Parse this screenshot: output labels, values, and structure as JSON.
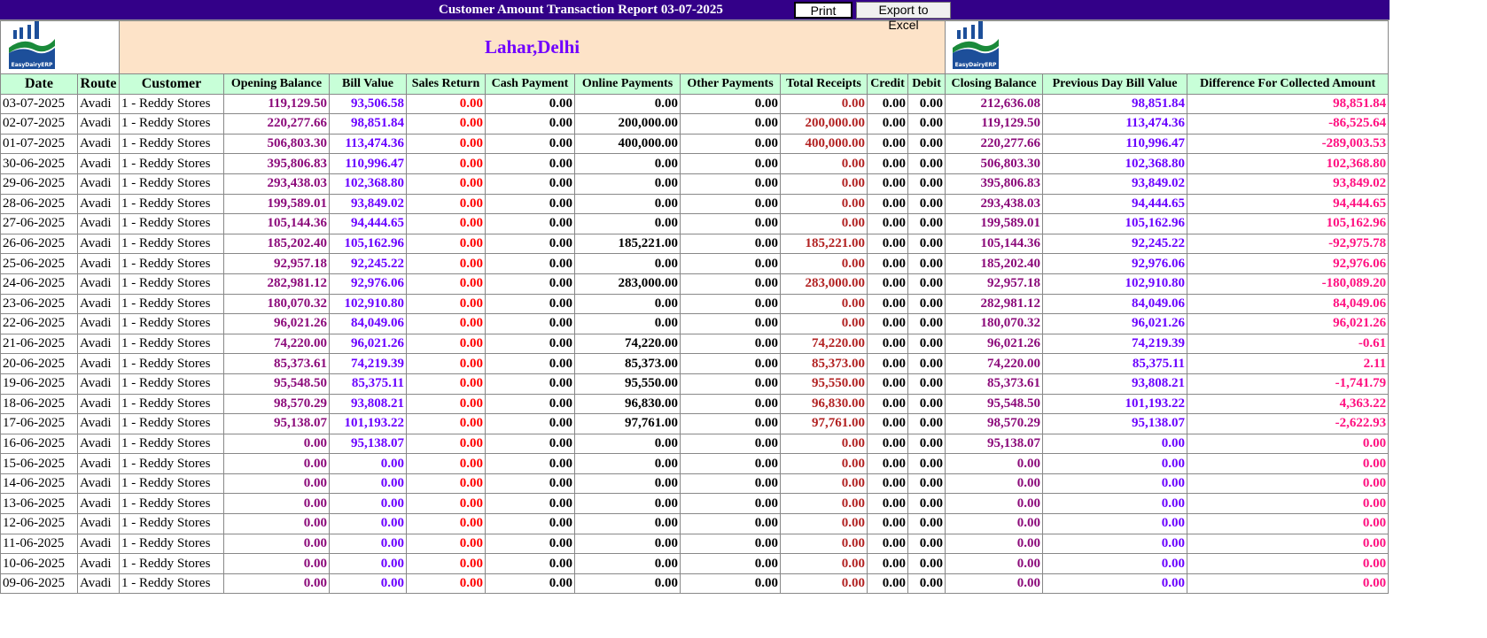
{
  "header": {
    "title": "Customer Amount Transaction Report 03-07-2025",
    "print_label": "Print",
    "export_label": "Export to Excel"
  },
  "company": {
    "name": "Lahar,Delhi",
    "logo_text": "EasyDairyERP"
  },
  "columns": [
    "Date",
    "Route",
    "Customer",
    "Opening Balance",
    "Bill Value",
    "Sales Return",
    "Cash Payment",
    "Online Payments",
    "Other Payments",
    "Total Receipts",
    "Credit",
    "Debit",
    "Closing Balance",
    "Previous Day Bill Value",
    "Difference For Collected Amount"
  ],
  "colors": {
    "title_bar": "#330088",
    "header_bg": "#c8ffd8",
    "company_bg": "#fde3c8",
    "opening": "#8b0a7a",
    "bill": "#6a00ff",
    "sales_return": "#ff0000",
    "receipts": "#b22222",
    "difference": "#ff1080"
  },
  "rows": [
    [
      "03-07-2025",
      "Avadi",
      "1 - Reddy Stores",
      "119,129.50",
      "93,506.58",
      "0.00",
      "0.00",
      "0.00",
      "0.00",
      "0.00",
      "0.00",
      "0.00",
      "212,636.08",
      "98,851.84",
      "98,851.84"
    ],
    [
      "02-07-2025",
      "Avadi",
      "1 - Reddy Stores",
      "220,277.66",
      "98,851.84",
      "0.00",
      "0.00",
      "200,000.00",
      "0.00",
      "200,000.00",
      "0.00",
      "0.00",
      "119,129.50",
      "113,474.36",
      "-86,525.64"
    ],
    [
      "01-07-2025",
      "Avadi",
      "1 - Reddy Stores",
      "506,803.30",
      "113,474.36",
      "0.00",
      "0.00",
      "400,000.00",
      "0.00",
      "400,000.00",
      "0.00",
      "0.00",
      "220,277.66",
      "110,996.47",
      "-289,003.53"
    ],
    [
      "30-06-2025",
      "Avadi",
      "1 - Reddy Stores",
      "395,806.83",
      "110,996.47",
      "0.00",
      "0.00",
      "0.00",
      "0.00",
      "0.00",
      "0.00",
      "0.00",
      "506,803.30",
      "102,368.80",
      "102,368.80"
    ],
    [
      "29-06-2025",
      "Avadi",
      "1 - Reddy Stores",
      "293,438.03",
      "102,368.80",
      "0.00",
      "0.00",
      "0.00",
      "0.00",
      "0.00",
      "0.00",
      "0.00",
      "395,806.83",
      "93,849.02",
      "93,849.02"
    ],
    [
      "28-06-2025",
      "Avadi",
      "1 - Reddy Stores",
      "199,589.01",
      "93,849.02",
      "0.00",
      "0.00",
      "0.00",
      "0.00",
      "0.00",
      "0.00",
      "0.00",
      "293,438.03",
      "94,444.65",
      "94,444.65"
    ],
    [
      "27-06-2025",
      "Avadi",
      "1 - Reddy Stores",
      "105,144.36",
      "94,444.65",
      "0.00",
      "0.00",
      "0.00",
      "0.00",
      "0.00",
      "0.00",
      "0.00",
      "199,589.01",
      "105,162.96",
      "105,162.96"
    ],
    [
      "26-06-2025",
      "Avadi",
      "1 - Reddy Stores",
      "185,202.40",
      "105,162.96",
      "0.00",
      "0.00",
      "185,221.00",
      "0.00",
      "185,221.00",
      "0.00",
      "0.00",
      "105,144.36",
      "92,245.22",
      "-92,975.78"
    ],
    [
      "25-06-2025",
      "Avadi",
      "1 - Reddy Stores",
      "92,957.18",
      "92,245.22",
      "0.00",
      "0.00",
      "0.00",
      "0.00",
      "0.00",
      "0.00",
      "0.00",
      "185,202.40",
      "92,976.06",
      "92,976.06"
    ],
    [
      "24-06-2025",
      "Avadi",
      "1 - Reddy Stores",
      "282,981.12",
      "92,976.06",
      "0.00",
      "0.00",
      "283,000.00",
      "0.00",
      "283,000.00",
      "0.00",
      "0.00",
      "92,957.18",
      "102,910.80",
      "-180,089.20"
    ],
    [
      "23-06-2025",
      "Avadi",
      "1 - Reddy Stores",
      "180,070.32",
      "102,910.80",
      "0.00",
      "0.00",
      "0.00",
      "0.00",
      "0.00",
      "0.00",
      "0.00",
      "282,981.12",
      "84,049.06",
      "84,049.06"
    ],
    [
      "22-06-2025",
      "Avadi",
      "1 - Reddy Stores",
      "96,021.26",
      "84,049.06",
      "0.00",
      "0.00",
      "0.00",
      "0.00",
      "0.00",
      "0.00",
      "0.00",
      "180,070.32",
      "96,021.26",
      "96,021.26"
    ],
    [
      "21-06-2025",
      "Avadi",
      "1 - Reddy Stores",
      "74,220.00",
      "96,021.26",
      "0.00",
      "0.00",
      "74,220.00",
      "0.00",
      "74,220.00",
      "0.00",
      "0.00",
      "96,021.26",
      "74,219.39",
      "-0.61"
    ],
    [
      "20-06-2025",
      "Avadi",
      "1 - Reddy Stores",
      "85,373.61",
      "74,219.39",
      "0.00",
      "0.00",
      "85,373.00",
      "0.00",
      "85,373.00",
      "0.00",
      "0.00",
      "74,220.00",
      "85,375.11",
      "2.11"
    ],
    [
      "19-06-2025",
      "Avadi",
      "1 - Reddy Stores",
      "95,548.50",
      "85,375.11",
      "0.00",
      "0.00",
      "95,550.00",
      "0.00",
      "95,550.00",
      "0.00",
      "0.00",
      "85,373.61",
      "93,808.21",
      "-1,741.79"
    ],
    [
      "18-06-2025",
      "Avadi",
      "1 - Reddy Stores",
      "98,570.29",
      "93,808.21",
      "0.00",
      "0.00",
      "96,830.00",
      "0.00",
      "96,830.00",
      "0.00",
      "0.00",
      "95,548.50",
      "101,193.22",
      "4,363.22"
    ],
    [
      "17-06-2025",
      "Avadi",
      "1 - Reddy Stores",
      "95,138.07",
      "101,193.22",
      "0.00",
      "0.00",
      "97,761.00",
      "0.00",
      "97,761.00",
      "0.00",
      "0.00",
      "98,570.29",
      "95,138.07",
      "-2,622.93"
    ],
    [
      "16-06-2025",
      "Avadi",
      "1 - Reddy Stores",
      "0.00",
      "95,138.07",
      "0.00",
      "0.00",
      "0.00",
      "0.00",
      "0.00",
      "0.00",
      "0.00",
      "95,138.07",
      "0.00",
      "0.00"
    ],
    [
      "15-06-2025",
      "Avadi",
      "1 - Reddy Stores",
      "0.00",
      "0.00",
      "0.00",
      "0.00",
      "0.00",
      "0.00",
      "0.00",
      "0.00",
      "0.00",
      "0.00",
      "0.00",
      "0.00"
    ],
    [
      "14-06-2025",
      "Avadi",
      "1 - Reddy Stores",
      "0.00",
      "0.00",
      "0.00",
      "0.00",
      "0.00",
      "0.00",
      "0.00",
      "0.00",
      "0.00",
      "0.00",
      "0.00",
      "0.00"
    ],
    [
      "13-06-2025",
      "Avadi",
      "1 - Reddy Stores",
      "0.00",
      "0.00",
      "0.00",
      "0.00",
      "0.00",
      "0.00",
      "0.00",
      "0.00",
      "0.00",
      "0.00",
      "0.00",
      "0.00"
    ],
    [
      "12-06-2025",
      "Avadi",
      "1 - Reddy Stores",
      "0.00",
      "0.00",
      "0.00",
      "0.00",
      "0.00",
      "0.00",
      "0.00",
      "0.00",
      "0.00",
      "0.00",
      "0.00",
      "0.00"
    ],
    [
      "11-06-2025",
      "Avadi",
      "1 - Reddy Stores",
      "0.00",
      "0.00",
      "0.00",
      "0.00",
      "0.00",
      "0.00",
      "0.00",
      "0.00",
      "0.00",
      "0.00",
      "0.00",
      "0.00"
    ],
    [
      "10-06-2025",
      "Avadi",
      "1 - Reddy Stores",
      "0.00",
      "0.00",
      "0.00",
      "0.00",
      "0.00",
      "0.00",
      "0.00",
      "0.00",
      "0.00",
      "0.00",
      "0.00",
      "0.00"
    ],
    [
      "09-06-2025",
      "Avadi",
      "1 - Reddy Stores",
      "0.00",
      "0.00",
      "0.00",
      "0.00",
      "0.00",
      "0.00",
      "0.00",
      "0.00",
      "0.00",
      "0.00",
      "0.00",
      "0.00"
    ]
  ]
}
